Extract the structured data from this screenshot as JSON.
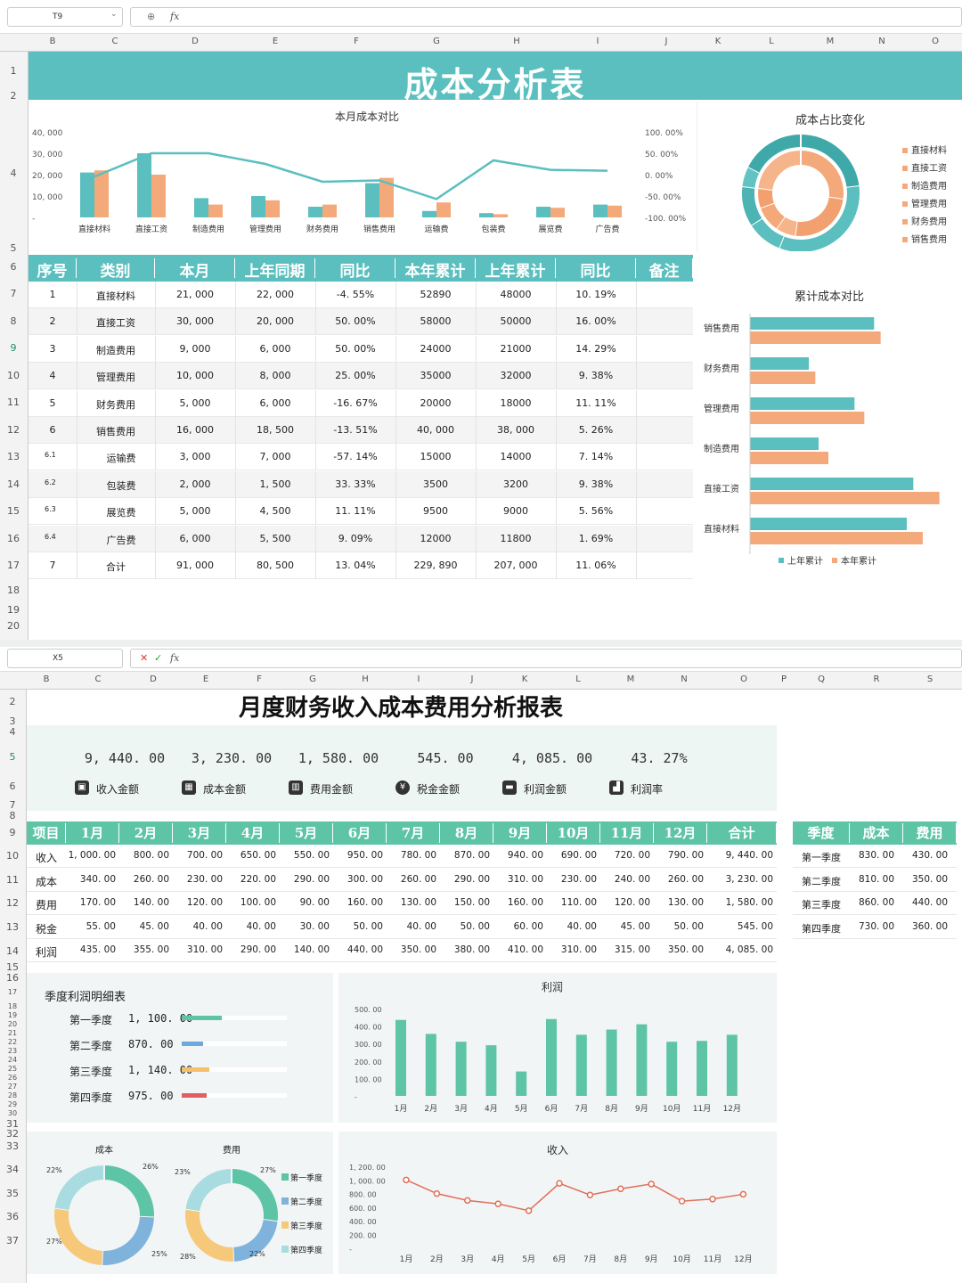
{
  "top": {
    "namebox": "T9",
    "title": "成本分析表",
    "cols": [
      "B",
      "C",
      "D",
      "E",
      "F",
      "G",
      "H",
      "I",
      "J",
      "K",
      "L",
      "M",
      "N",
      "O"
    ],
    "rows": [
      "1",
      "2",
      "4",
      "5",
      "6",
      "7",
      "8",
      "9",
      "10",
      "11",
      "12",
      "13",
      "14",
      "15",
      "16",
      "17",
      "18",
      "19",
      "20"
    ],
    "table": {
      "headers": [
        "序号",
        "类别",
        "本月",
        "上年同期",
        "同比",
        "本年累计",
        "上年累计",
        "同比",
        "备注"
      ],
      "rows": [
        [
          "1",
          "直接材料",
          "21, 000",
          "22, 000",
          "-4. 55%",
          "52890",
          "48000",
          "10. 19%",
          ""
        ],
        [
          "2",
          "直接工资",
          "30, 000",
          "20, 000",
          "50. 00%",
          "58000",
          "50000",
          "16. 00%",
          ""
        ],
        [
          "3",
          "制造费用",
          "9, 000",
          "6, 000",
          "50. 00%",
          "24000",
          "21000",
          "14. 29%",
          ""
        ],
        [
          "4",
          "管理费用",
          "10, 000",
          "8, 000",
          "25. 00%",
          "35000",
          "32000",
          "9. 38%",
          ""
        ],
        [
          "5",
          "财务费用",
          "5, 000",
          "6, 000",
          "-16. 67%",
          "20000",
          "18000",
          "11. 11%",
          ""
        ],
        [
          "6",
          "销售费用",
          "16, 000",
          "18, 500",
          "-13. 51%",
          "40, 000",
          "38, 000",
          "5. 26%",
          ""
        ],
        [
          "6.1",
          "运输费",
          "3, 000",
          "7, 000",
          "-57. 14%",
          "15000",
          "14000",
          "7. 14%",
          ""
        ],
        [
          "6.2",
          "包装费",
          "2, 000",
          "1, 500",
          "33. 33%",
          "3500",
          "3200",
          "9. 38%",
          ""
        ],
        [
          "6.3",
          "展览费",
          "5, 000",
          "4, 500",
          "11. 11%",
          "9500",
          "9000",
          "5. 56%",
          ""
        ],
        [
          "6.4",
          "广告费",
          "6, 000",
          "5, 500",
          "9. 09%",
          "12000",
          "11800",
          "1. 69%",
          ""
        ],
        [
          "7",
          "合计",
          "91, 000",
          "80, 500",
          "13. 04%",
          "229, 890",
          "207, 000",
          "11. 06%",
          ""
        ]
      ]
    },
    "chart1": {
      "title": "本月成本对比",
      "yticks": [
        "40, 000",
        "30, 000",
        "20, 000",
        "10, 000",
        "-"
      ],
      "y2ticks": [
        "100. 00%",
        "50. 00%",
        "0. 00%",
        "-50. 00%",
        "-100. 00%"
      ]
    },
    "chart2": {
      "title": "成本占比变化",
      "legend": [
        "直接材料",
        "直接工资",
        "制造费用",
        "管理费用",
        "财务费用",
        "销售费用"
      ]
    },
    "chart3": {
      "title": "累计成本对比",
      "legend": [
        "上年累计",
        "本年累计"
      ]
    }
  },
  "bottom": {
    "namebox": "X5",
    "cols": [
      "B",
      "C",
      "D",
      "E",
      "F",
      "G",
      "H",
      "I",
      "J",
      "K",
      "L",
      "M",
      "N",
      "O",
      "P",
      "Q",
      "R",
      "S"
    ],
    "rows": [
      "2",
      "3",
      "4",
      "5",
      "6",
      "7",
      "8",
      "9",
      "10",
      "11",
      "12",
      "13",
      "14",
      "15",
      "16",
      "17",
      "18",
      "19",
      "20",
      "21",
      "22",
      "23",
      "24",
      "25",
      "26",
      "27",
      "28",
      "29",
      "30",
      "31",
      "32",
      "33",
      "34",
      "35",
      "36",
      "37"
    ],
    "title": "月度财务收入成本费用分析报表",
    "kpis": [
      {
        "value": "9, 440. 00",
        "label": "收入金额",
        "icon": "wallet-icon"
      },
      {
        "value": "3, 230. 00",
        "label": "成本金额",
        "icon": "calculator-icon"
      },
      {
        "value": "1, 580. 00",
        "label": "费用金额",
        "icon": "bar-chart-icon"
      },
      {
        "value": "545. 00",
        "label": "税金金额",
        "icon": "yen-coin-icon"
      },
      {
        "value": "4, 085. 00",
        "label": "利润金额",
        "icon": "folder-money-icon"
      },
      {
        "value": "43. 27%",
        "label": "利润率",
        "icon": "growth-icon"
      }
    ],
    "table": {
      "headers": [
        "项目",
        "1月",
        "2月",
        "3月",
        "4月",
        "5月",
        "6月",
        "7月",
        "8月",
        "9月",
        "10月",
        "11月",
        "12月",
        "合计"
      ],
      "rows": [
        [
          "收入",
          "1, 000. 00",
          "800. 00",
          "700. 00",
          "650. 00",
          "550. 00",
          "950. 00",
          "780. 00",
          "870. 00",
          "940. 00",
          "690. 00",
          "720. 00",
          "790. 00",
          "9, 440. 00"
        ],
        [
          "成本",
          "340. 00",
          "260. 00",
          "230. 00",
          "220. 00",
          "290. 00",
          "300. 00",
          "260. 00",
          "290. 00",
          "310. 00",
          "230. 00",
          "240. 00",
          "260. 00",
          "3, 230. 00"
        ],
        [
          "费用",
          "170. 00",
          "140. 00",
          "120. 00",
          "100. 00",
          "90. 00",
          "160. 00",
          "130. 00",
          "150. 00",
          "160. 00",
          "110. 00",
          "120. 00",
          "130. 00",
          "1, 580. 00"
        ],
        [
          "税金",
          "55. 00",
          "45. 00",
          "40. 00",
          "40. 00",
          "30. 00",
          "50. 00",
          "40. 00",
          "50. 00",
          "60. 00",
          "40. 00",
          "45. 00",
          "50. 00",
          "545. 00"
        ],
        [
          "利润",
          "435. 00",
          "355. 00",
          "310. 00",
          "290. 00",
          "140. 00",
          "440. 00",
          "350. 00",
          "380. 00",
          "410. 00",
          "310. 00",
          "315. 00",
          "350. 00",
          "4, 085. 00"
        ]
      ]
    },
    "qtable": {
      "headers": [
        "季度",
        "成本",
        "费用"
      ],
      "rows": [
        [
          "第一季度",
          "830. 00",
          "430. 00"
        ],
        [
          "第二季度",
          "810. 00",
          "350. 00"
        ],
        [
          "第三季度",
          "860. 00",
          "440. 00"
        ],
        [
          "第四季度",
          "730. 00",
          "360. 00"
        ]
      ]
    },
    "qprofit": {
      "title": "季度利润明细表",
      "rows": [
        {
          "label": "第一季度",
          "value": "1, 100. 00",
          "fraction": 0.38,
          "color": "#5ec4a6"
        },
        {
          "label": "第二季度",
          "value": "870. 00",
          "fraction": 0.2,
          "color": "#6fa8dc"
        },
        {
          "label": "第三季度",
          "value": "1, 140. 00",
          "fraction": 0.26,
          "color": "#f6c06a"
        },
        {
          "label": "第四季度",
          "value": "975. 00",
          "fraction": 0.24,
          "color": "#e06060"
        }
      ]
    },
    "donuts": {
      "legend": [
        "第一季度",
        "第二季度",
        "第三季度",
        "第四季度"
      ]
    },
    "colors": {
      "teal": "#5bbfbf",
      "green": "#5ec4a6",
      "orange": "#f4a97a",
      "line": "#e0705a"
    }
  },
  "chart_data": [
    {
      "type": "bar",
      "title": "本月成本对比",
      "categories": [
        "直接材料",
        "直接工资",
        "制造费用",
        "管理费用",
        "财务费用",
        "销售费用",
        "运输费",
        "包装费",
        "展览费",
        "广告费"
      ],
      "series": [
        {
          "values": [
            21000,
            30000,
            9000,
            10000,
            5000,
            16000,
            3000,
            2000,
            5000,
            6000
          ]
        },
        {
          "values": [
            22000,
            20000,
            6000,
            8000,
            6000,
            18500,
            7000,
            1500,
            4500,
            5500
          ]
        },
        {
          "values": [
            -4.55,
            50,
            50,
            25,
            -16.67,
            -13.51,
            -57.14,
            33.33,
            11.11,
            9.09
          ]
        }
      ],
      "ylim": [
        0,
        40000
      ],
      "y2lim": [
        -100,
        100
      ]
    },
    {
      "type": "pie",
      "title": "成本占比变化",
      "categories": [
        "直接材料",
        "直接工资",
        "制造费用",
        "管理费用",
        "财务费用",
        "销售费用"
      ],
      "series": [
        {
          "values": [
            21000,
            30000,
            9000,
            10000,
            5000,
            16000
          ]
        },
        {
          "values": [
            22000,
            20000,
            6000,
            8000,
            6000,
            18500
          ]
        }
      ]
    },
    {
      "type": "bar",
      "title": "累计成本对比",
      "categories": [
        "销售费用",
        "财务费用",
        "管理费用",
        "制造费用",
        "直接工资",
        "直接材料"
      ],
      "series": [
        {
          "name": "上年累计",
          "values": [
            38000,
            18000,
            32000,
            21000,
            50000,
            48000
          ]
        },
        {
          "name": "本年累计",
          "values": [
            40000,
            20000,
            35000,
            24000,
            58000,
            52890
          ]
        }
      ]
    },
    {
      "type": "bar",
      "title": "利润",
      "categories": [
        "1月",
        "2月",
        "3月",
        "4月",
        "5月",
        "6月",
        "7月",
        "8月",
        "9月",
        "10月",
        "11月",
        "12月"
      ],
      "values": [
        435,
        355,
        310,
        290,
        140,
        440,
        350,
        380,
        410,
        310,
        315,
        350
      ],
      "ylim": [
        0,
        500
      ],
      "yticks": [
        "500. 00",
        "400. 00",
        "300. 00",
        "200. 00",
        "100. 00",
        "-"
      ]
    },
    {
      "type": "pie",
      "title": "成本",
      "categories": [
        "第一季度",
        "第二季度",
        "第三季度",
        "第四季度"
      ],
      "values": [
        830,
        810,
        860,
        730
      ],
      "labels": [
        "26%",
        "25%",
        "27%",
        "22%"
      ]
    },
    {
      "type": "pie",
      "title": "费用",
      "categories": [
        "第一季度",
        "第二季度",
        "第三季度",
        "第四季度"
      ],
      "values": [
        430,
        350,
        440,
        360
      ],
      "labels": [
        "27%",
        "22%",
        "28%",
        "23%"
      ]
    },
    {
      "type": "line",
      "title": "收入",
      "categories": [
        "1月",
        "2月",
        "3月",
        "4月",
        "5月",
        "6月",
        "7月",
        "8月",
        "9月",
        "10月",
        "11月",
        "12月"
      ],
      "values": [
        1000,
        800,
        700,
        650,
        550,
        950,
        780,
        870,
        940,
        690,
        720,
        790
      ],
      "ylim": [
        0,
        1200
      ],
      "yticks": [
        "1, 200. 00",
        "1, 000. 00",
        "800. 00",
        "600. 00",
        "400. 00",
        "200. 00",
        "-"
      ]
    }
  ]
}
